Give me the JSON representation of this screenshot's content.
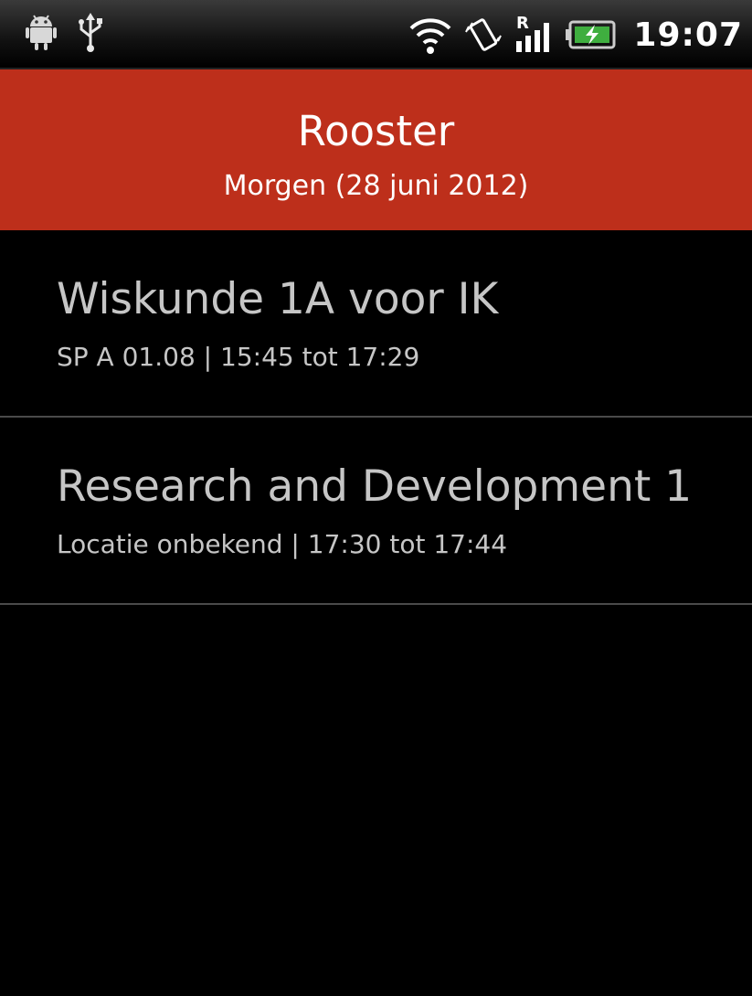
{
  "status_bar": {
    "time": "19:07",
    "left_icons": [
      "android-debug-icon",
      "usb-icon"
    ],
    "right_icons": [
      "wifi-icon",
      "vibrate-icon",
      "signal-roaming-icon",
      "battery-charging-icon"
    ]
  },
  "header": {
    "title": "Rooster",
    "subtitle": "Morgen (28 juni 2012)",
    "color": "#bd2f1b"
  },
  "schedule": [
    {
      "title": "Wiskunde 1A voor IK",
      "detail": "SP A 01.08 | 15:45 tot 17:29"
    },
    {
      "title": "Research and Development 1",
      "detail": "Locatie onbekend | 17:30 tot 17:44"
    }
  ]
}
